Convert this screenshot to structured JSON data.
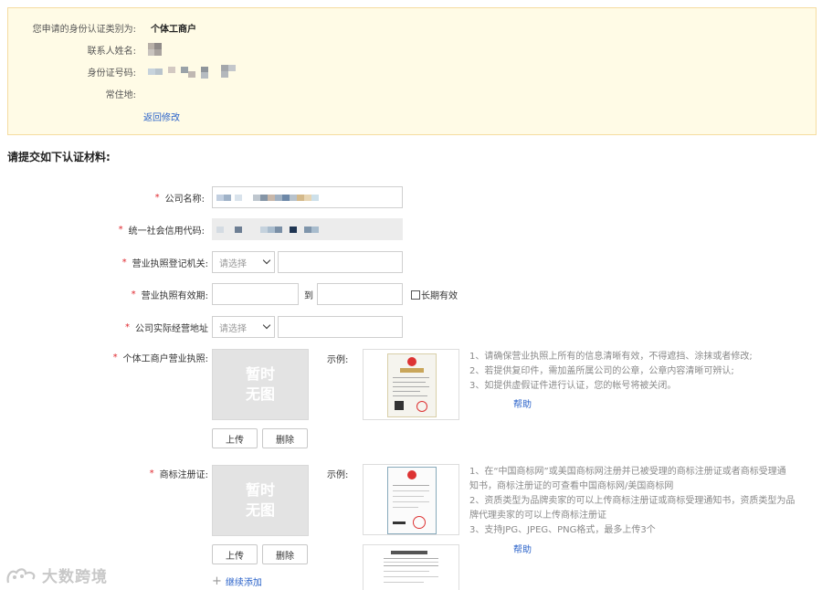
{
  "applicant": {
    "type_label": "您申请的身份认证类别为:",
    "type_value": "个体工商户",
    "contact_label": "联系人姓名:",
    "id_label": "身份证号码:",
    "address_label": "常住地:",
    "back_link": "返回修改"
  },
  "section_title": "请提交如下认证材料:",
  "form": {
    "company_name_label": "公司名称:",
    "credit_code_label": "统一社会信用代码:",
    "reg_authority_label": "营业执照登记机关:",
    "reg_authority_placeholder": "请选择",
    "validity_label": "营业执照有效期:",
    "validity_to": "到",
    "long_term_label": "长期有效",
    "address_label": "公司实际经营地址",
    "address_placeholder": "请选择"
  },
  "license": {
    "label": "个体工商户营业执照:",
    "placeholder_line1": "暂时",
    "placeholder_line2": "无图",
    "sample_label": "示例:",
    "upload": "上传",
    "delete": "删除",
    "notes": [
      "1、请确保营业执照上所有的信息清晰有效，不得遮挡、涂抹或者修改;",
      "2、若提供复印件，需加盖所属公司的公章，公章内容清晰可辨认;",
      "3、如提供虚假证件进行认证，您的帐号将被关闭。"
    ],
    "help": "帮助"
  },
  "trademark": {
    "label": "商标注册证:",
    "placeholder_line1": "暂时",
    "placeholder_line2": "无图",
    "sample_label": "示例:",
    "upload": "上传",
    "delete": "删除",
    "notes": [
      "1、在“中国商标网”或美国商标网注册并已被受理的商标注册证或者商标受理通",
      "知书，商标注册证的可查看中国商标网/美国商标网",
      "2、资质类型为品牌卖家的可以上传商标注册证或商标受理通知书，资质类型为品",
      "牌代理卖家的可以上传商标注册证",
      "3、支持JPG、JPEG、PNG格式，最多上传3个"
    ],
    "help": "帮助",
    "add_more": "继续添加"
  },
  "watermark_text": "大数跨境",
  "colors": {
    "info_bg": "#fffbe6",
    "required": "#e0282e",
    "link": "#2a62c9"
  }
}
